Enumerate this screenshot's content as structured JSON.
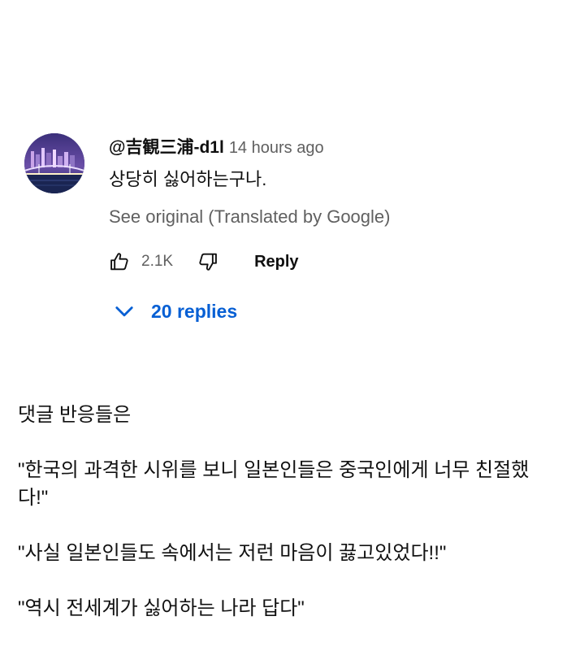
{
  "comment": {
    "avatar_icon": "avatar-night-bridge-image",
    "author": "@吉観三浦-d1l",
    "time": "14 hours ago",
    "text": "상당히 싫어하는구나.",
    "see_original": "See original (Translated by Google)",
    "likes": "2.1K",
    "like_icon": "thumbs-up-icon",
    "dislike_icon": "thumbs-down-icon",
    "reply_label": "Reply",
    "replies_toggle_icon": "chevron-down-icon",
    "replies_label": "20 replies",
    "colors": {
      "link_blue": "#065fd4",
      "secondary_text": "#606060",
      "primary_text": "#0f0f0f"
    }
  },
  "post": {
    "line1": "댓글 반응들은",
    "line2": "\"한국의 과격한 시위를 보니 일본인들은 중국인에게 너무 친절했다!\"",
    "line3": "\"사실 일본인들도 속에서는 저런 마음이 끓고있었다!!\"",
    "line4": "\"역시 전세계가 싫어하는 나라 답다\""
  }
}
